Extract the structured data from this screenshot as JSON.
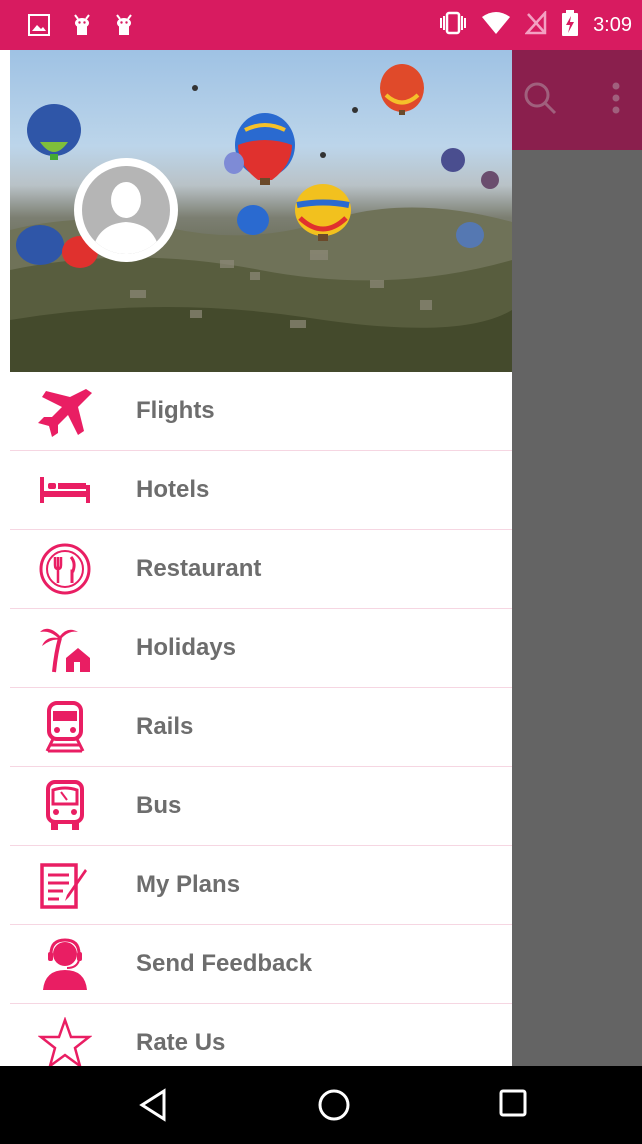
{
  "status_bar": {
    "time": "3:09",
    "color": "#d81b60",
    "left_icons": [
      "gallery-icon",
      "android-debug-icon",
      "android-debug-icon"
    ],
    "right_icons": [
      "vibrate-icon",
      "wifi-icon",
      "no-sim-icon",
      "battery-charging-icon"
    ]
  },
  "app_bar": {
    "icons": [
      "search-icon",
      "overflow-menu-icon"
    ]
  },
  "drawer": {
    "accent": "#e91e63",
    "header": {
      "avatar": "avatar"
    },
    "items": [
      {
        "label": "Flights",
        "icon": "airplane-icon"
      },
      {
        "label": "Hotels",
        "icon": "bed-icon"
      },
      {
        "label": "Restaurant",
        "icon": "restaurant-icon"
      },
      {
        "label": "Holidays",
        "icon": "palm-house-icon"
      },
      {
        "label": "Rails",
        "icon": "train-icon"
      },
      {
        "label": "Bus",
        "icon": "bus-icon"
      },
      {
        "label": "My Plans",
        "icon": "notepad-icon"
      },
      {
        "label": "Send Feedback",
        "icon": "headset-person-icon"
      },
      {
        "label": "Rate Us",
        "icon": "star-icon"
      }
    ]
  },
  "nav_bar": {
    "buttons": [
      "back-icon",
      "home-icon",
      "recents-icon"
    ]
  }
}
